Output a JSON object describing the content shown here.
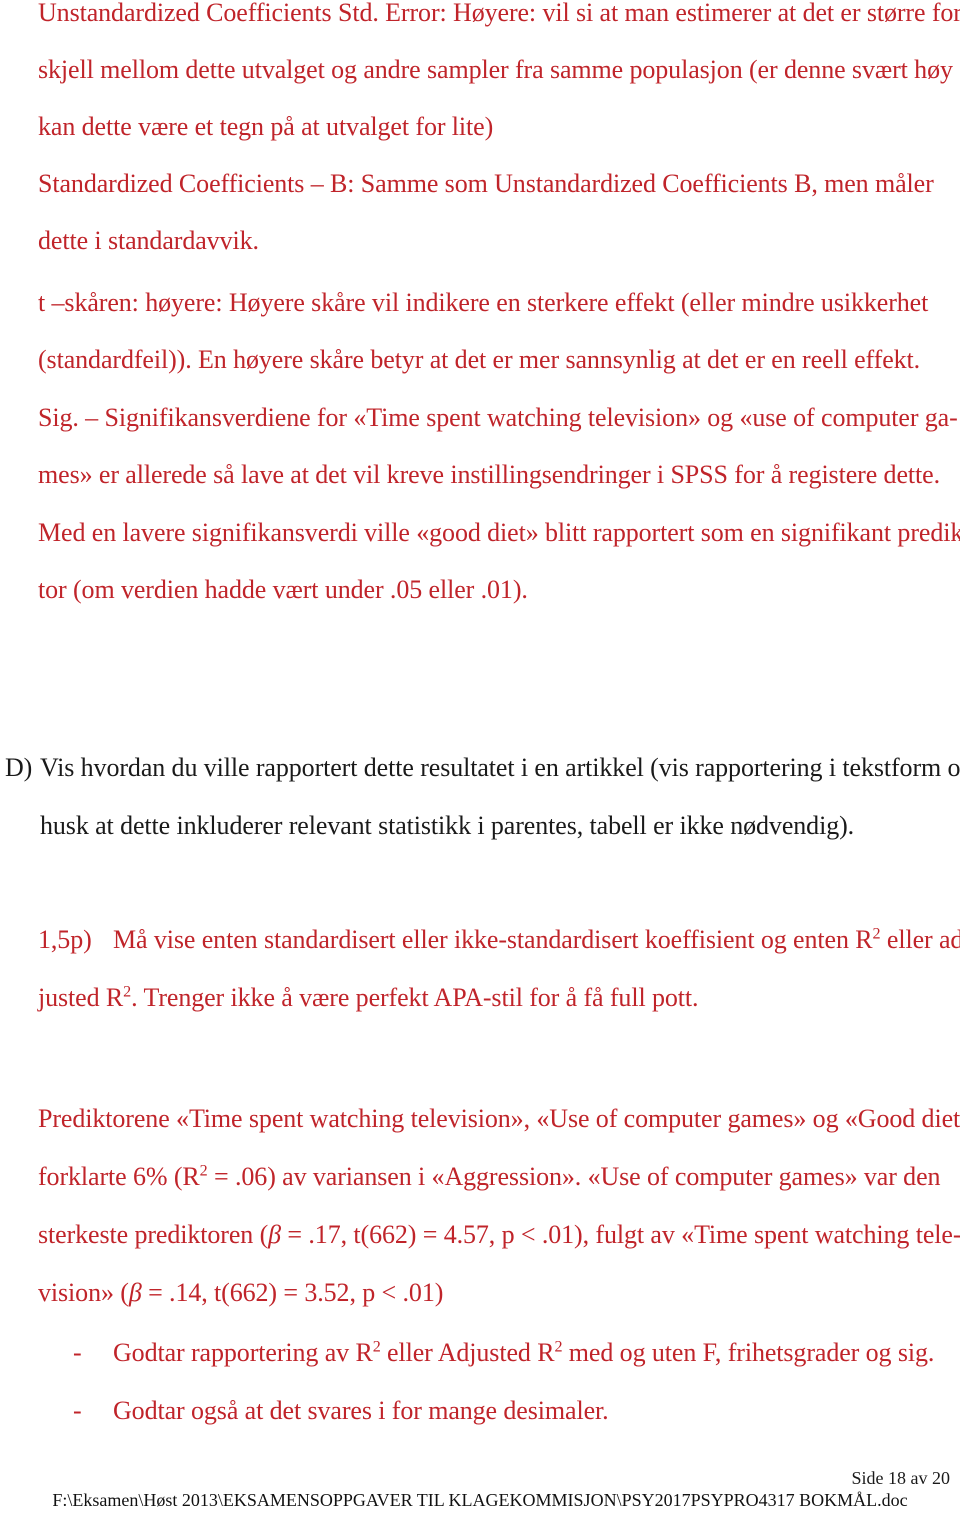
{
  "document": {
    "text_color_red": "#C0242A",
    "text_color_black": "#1a1a1a",
    "background": "#ffffff"
  },
  "body_lines": [
    {
      "id": "l1",
      "text": "Unstandardized Coefficients Std. Error: Høyere: vil si at man estimerer at det er større for-"
    },
    {
      "id": "l2",
      "text": "skjell mellom dette utvalget og andre sampler fra samme populasjon (er denne svært høy"
    },
    {
      "id": "l3",
      "text": "kan dette være et tegn på at utvalget for lite)"
    },
    {
      "id": "l4",
      "text": "Standardized Coefficients – B: Samme som Unstandardized Coefficients B, men måler"
    },
    {
      "id": "l5",
      "text": "dette i standardavvik."
    },
    {
      "id": "l6",
      "text": "t –skåren: høyere: Høyere skåre vil indikere en sterkere effekt (eller mindre usikkerhet"
    },
    {
      "id": "l7",
      "text": "(standardfeil)). En høyere skåre betyr at det er mer sannsynlig at det er en reell effekt."
    },
    {
      "id": "l8",
      "text": "Sig. – Signifikansverdiene for «Time spent watching television» og «use of computer ga-"
    },
    {
      "id": "l9",
      "text": "mes» er allerede så lave at det vil kreve instillingsendringer i SPSS for å registere dette."
    },
    {
      "id": "l10",
      "text": "Med en lavere signifikansverdi ville «good diet» blitt rapportert som en signifikant predik-"
    },
    {
      "id": "l11",
      "text": "tor (om verdien hadde vært under .05 eller .01)."
    }
  ],
  "question_d": {
    "marker": "D)",
    "line1": "Vis hvordan du ville rapportert dette resultatet i en artikkel (vis rapportering i tekstform og",
    "line2": "husk at dette inkluderer relevant statistikk i parentes, tabell er ikke nødvendig)."
  },
  "points_note": {
    "marker": "1,5p)",
    "line1_before_sup": "Må vise enten standardisert eller ikke-standardisert koeffisient og enten R",
    "line1_sup": "2",
    "line1_after_sup": " eller ad-",
    "line2_before_sup": "justed R",
    "line2_sup": "2",
    "line2_after_sup": ". Trenger ikke å være perfekt APA-stil for å få full pott."
  },
  "example_report": {
    "line1": "Prediktorene «Time spent watching television», «Use of computer games» og «Good diet»",
    "line2_a": "forklarte 6% (R",
    "line2_sup": "2",
    "line2_b": " = .06) av variansen i «Aggression». «Use of computer games» var den",
    "line3_a": "sterkeste prediktoren (",
    "line3_beta": "β",
    "line3_b": " = .17, t(662) = 4.57, p < .01), fulgt av «Time spent watching tele-",
    "line4_a": "vision» (",
    "line4_beta": "β",
    "line4_b": " = .14, t(662) = 3.52, p < .01)"
  },
  "accept_notes": [
    {
      "marker": "-",
      "a": "Godtar rapportering av R",
      "sup1": "2",
      "b": " eller Adjusted R",
      "sup2": "2",
      "c": " med og uten F, frihetsgrader og sig."
    },
    {
      "marker": "-",
      "a": "Godtar også at det svares i for mange desimaler.",
      "sup1": "",
      "b": "",
      "sup2": "",
      "c": ""
    }
  ],
  "footer": {
    "page_number": "Side 18 av 20",
    "file_path": "F:\\Eksamen\\Høst 2013\\EKSAMENSOPPGAVER TIL KLAGEKOMMISJON\\PSY2017PSYPRO4317 BOKMÅL.doc"
  }
}
